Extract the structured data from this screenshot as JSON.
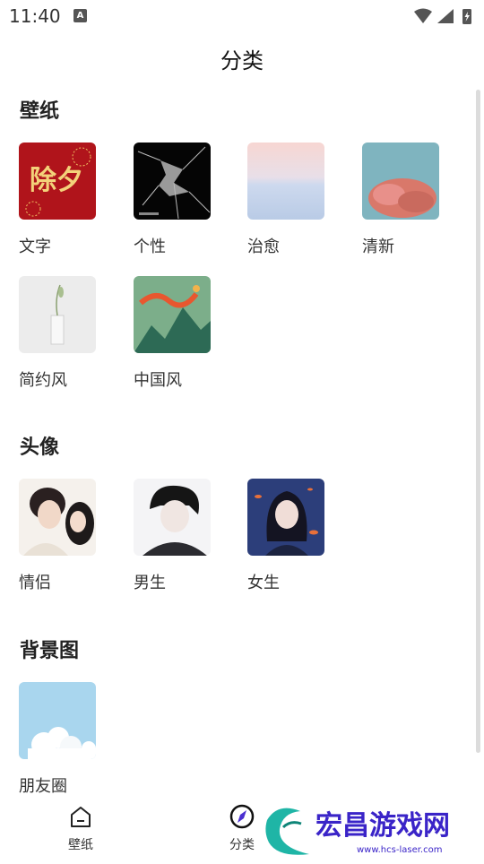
{
  "status": {
    "time": "11:40",
    "notif_letter": "A"
  },
  "header": {
    "title": "分类"
  },
  "sections": [
    {
      "title": "壁纸",
      "items": [
        {
          "label": "文字",
          "thumb_text": "除夕"
        },
        {
          "label": "个性"
        },
        {
          "label": "治愈"
        },
        {
          "label": "清新"
        },
        {
          "label": "简约风"
        },
        {
          "label": "中国风"
        }
      ]
    },
    {
      "title": "头像",
      "items": [
        {
          "label": "情侣"
        },
        {
          "label": "男生"
        },
        {
          "label": "女生"
        }
      ]
    },
    {
      "title": "背景图",
      "items": [
        {
          "label": "朋友圈"
        }
      ]
    }
  ],
  "nav": [
    {
      "label": "壁纸",
      "icon": "home-icon"
    },
    {
      "label": "分类",
      "icon": "compass-icon"
    }
  ],
  "watermark": {
    "name": "宏昌游戏网",
    "url": "www.hcs-laser.com"
  },
  "colors": {
    "red": "#b0141b",
    "accent": "#4a2fd0",
    "watermark": "#3a24c8"
  }
}
